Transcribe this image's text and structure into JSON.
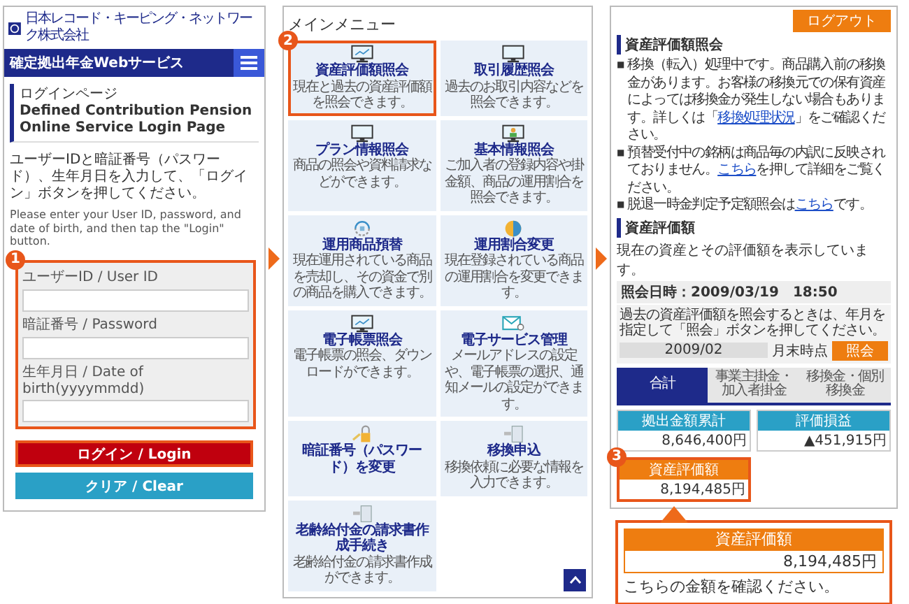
{
  "login_screen": {
    "company": "日本レコード・キーピング・ネットワーク株式会社",
    "service_title": "確定拠出年金Webサービス",
    "page_title": "ログインページ",
    "page_title_en": "Defined Contribution Pension Online Service Login Page",
    "instruction": "ユーザーIDと暗証番号（パスワード）、生年月日を入力して、「ログイン」ボタンを押してください。",
    "instruction_en": "Please enter your User ID, password, and date of birth, and then tap the \"Login\" button.",
    "step": "1",
    "form_highlighted": true,
    "fields": [
      {
        "label": "ユーザーID / User ID"
      },
      {
        "label": "暗証番号 / Password"
      },
      {
        "label": "生年月日 / Date of birth(yyyymmdd)"
      }
    ],
    "buttons": [
      {
        "label": "ログイン / Login",
        "kind": "primary",
        "highlighted": true
      },
      {
        "label": "クリア / Clear",
        "kind": "secondary",
        "highlighted": false
      }
    ]
  },
  "menu_screen": {
    "title": "メインメニュー",
    "step": "2",
    "tiles": [
      {
        "kind": "chart-monitor",
        "title": "資産評価額照会",
        "description": "現在と過去の資産評価額を照会できます。",
        "highlighted": true
      },
      {
        "kind": "monitor",
        "title": "取引履歴照会",
        "description": "過去のお取引内容などを照会できます。",
        "highlighted": false
      },
      {
        "kind": "monitor",
        "title": "プラン情報照会",
        "description": "商品の照会や資料請求などができます。",
        "highlighted": false
      },
      {
        "kind": "person-monitor",
        "title": "基本情報照会",
        "description": "ご加入者の登録内容や掛金額、商品の運用割合を照会できます。",
        "highlighted": false
      },
      {
        "kind": "cycle",
        "title": "運用商品預替",
        "description": "現在運用されている商品を売却し、その資金で別の商品を購入できます。",
        "highlighted": false
      },
      {
        "kind": "pie",
        "title": "運用割合変更",
        "description": "現在登録されている商品の運用割合を変更できます。",
        "highlighted": false
      },
      {
        "kind": "chart-monitor",
        "title": "電子帳票照会",
        "description": "電子帳票の照会、ダウンロードができます。",
        "highlighted": false
      },
      {
        "kind": "mail",
        "title": "電子サービス管理",
        "description": "メールアドレスの設定や、電子帳票の選択、通知メールの設定ができます。",
        "highlighted": false
      },
      {
        "kind": "lock",
        "title": "暗証番号（パスワード）を変更",
        "highlighted": false
      },
      {
        "kind": "document",
        "title": "移換申込",
        "description": "移換依頼に必要な情報を入力できます。",
        "highlighted": false
      },
      {
        "kind": "document",
        "title": "老齢給付金の請求書作成手続き",
        "description": "老齢給付金の請求書作成ができます。",
        "highlighted": false
      }
    ]
  },
  "asset_screen": {
    "logout": "ログアウト",
    "heading": "資産評価額照会",
    "notices": [
      {
        "marker": "■",
        "text": "移換（転入）処理中です。商品購入前の移換金があります。お客様の移換元での保有資産によっては移換金が発生しない場合もあります。詳しくは「**移換処理状況**」をご確認ください。"
      },
      {
        "marker": "■",
        "text": "預替受付中の銘柄は商品毎の内訳に反映されておりません。**こちら**を押して詳細をご覧ください。"
      },
      {
        "marker": "■",
        "text": "脱退一時金判定予定額照会は**こちら**です。"
      }
    ],
    "section_heading": "資産評価額",
    "description": "現在の資産とその評価額を表示しています。",
    "inquiry_datetime": "照会日時：2009/03/19　18:50",
    "past_note": "過去の資産評価額を照会するときは、年月を指定して「照会」ボタンを押してください。",
    "month_value": "2009/02",
    "month_suffix": "月末時点",
    "inquiry_button": "照会",
    "tabs": [
      {
        "label": "合計",
        "selected": true
      },
      {
        "label": "事業主掛金・加入者掛金",
        "selected": false
      },
      {
        "label": "移換金・個別移換金",
        "selected": false
      }
    ],
    "step": "3",
    "cards": [
      {
        "title": "拠出金額累計",
        "value": "8,646,400円",
        "highlighted": false
      },
      {
        "title": "評価損益",
        "value": "▲451,915円",
        "highlighted": false
      },
      {
        "title": "資産評価額",
        "value": "8,194,485円",
        "highlighted": true
      }
    ]
  },
  "callout": {
    "title": "資産評価額",
    "value": "8,194,485円",
    "message": "こちらの金額を確認ください。"
  }
}
